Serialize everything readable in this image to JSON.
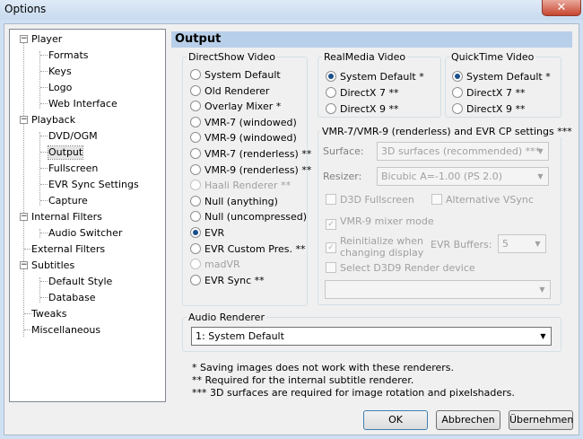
{
  "window": {
    "title": "Options",
    "close_glyph": "✕"
  },
  "tree": {
    "items": [
      {
        "label": "Player",
        "expander": "−"
      },
      {
        "label": "Formats"
      },
      {
        "label": "Keys"
      },
      {
        "label": "Logo"
      },
      {
        "label": "Web Interface"
      },
      {
        "label": "Playback",
        "expander": "−"
      },
      {
        "label": "DVD/OGM"
      },
      {
        "label": "Output",
        "selected": true
      },
      {
        "label": "Fullscreen"
      },
      {
        "label": "EVR Sync Settings"
      },
      {
        "label": "Capture"
      },
      {
        "label": "Internal Filters",
        "expander": "−"
      },
      {
        "label": "Audio Switcher"
      },
      {
        "label": "External Filters"
      },
      {
        "label": "Subtitles",
        "expander": "−"
      },
      {
        "label": "Default Style"
      },
      {
        "label": "Database"
      },
      {
        "label": "Tweaks"
      },
      {
        "label": "Miscellaneous"
      }
    ]
  },
  "page": {
    "header": "Output"
  },
  "directshow": {
    "label": "DirectShow Video",
    "options": [
      {
        "label": "System Default",
        "checked": false,
        "disabled": false
      },
      {
        "label": "Old Renderer",
        "checked": false,
        "disabled": false
      },
      {
        "label": "Overlay Mixer *",
        "checked": false,
        "disabled": false
      },
      {
        "label": "VMR-7 (windowed)",
        "checked": false,
        "disabled": false
      },
      {
        "label": "VMR-9 (windowed)",
        "checked": false,
        "disabled": false
      },
      {
        "label": "VMR-7 (renderless) **",
        "checked": false,
        "disabled": false
      },
      {
        "label": "VMR-9 (renderless) **",
        "checked": false,
        "disabled": false
      },
      {
        "label": "Haali Renderer **",
        "checked": false,
        "disabled": true
      },
      {
        "label": "Null (anything)",
        "checked": false,
        "disabled": false
      },
      {
        "label": "Null (uncompressed)",
        "checked": false,
        "disabled": false
      },
      {
        "label": "EVR",
        "checked": true,
        "disabled": false
      },
      {
        "label": "EVR Custom Pres. **",
        "checked": false,
        "disabled": false
      },
      {
        "label": "madVR",
        "checked": false,
        "disabled": true
      },
      {
        "label": "EVR Sync **",
        "checked": false,
        "disabled": false
      }
    ]
  },
  "realmedia": {
    "label": "RealMedia Video",
    "options": [
      {
        "label": "System Default *",
        "checked": true
      },
      {
        "label": "DirectX 7 **",
        "checked": false
      },
      {
        "label": "DirectX 9 **",
        "checked": false
      }
    ]
  },
  "quicktime": {
    "label": "QuickTime Video",
    "options": [
      {
        "label": "System Default *",
        "checked": true
      },
      {
        "label": "DirectX 7 **",
        "checked": false
      },
      {
        "label": "DirectX 9 **",
        "checked": false
      }
    ]
  },
  "evrcp": {
    "label": "VMR-7/VMR-9 (renderless) and EVR CP settings ***",
    "surface_label": "Surface:",
    "surface_value": "3D surfaces (recommended) ***",
    "resizer_label": "Resizer:",
    "resizer_value": "Bicubic A=-1.00 (PS 2.0)",
    "d3d_fullscreen": {
      "label": "D3D Fullscreen",
      "checked": false
    },
    "alt_vsync": {
      "label": "Alternative VSync",
      "checked": false
    },
    "vmr9_mixer": {
      "label": "VMR-9 mixer mode",
      "checked": true
    },
    "reinit": {
      "label": "Reinitialize when",
      "label2": "changing display",
      "checked": true
    },
    "evr_buffers_label": "EVR Buffers:",
    "evr_buffers_value": "5",
    "select_device": {
      "label": "Select D3D9 Render device",
      "checked": false
    },
    "device_value": ""
  },
  "audio": {
    "label": "Audio Renderer",
    "value": "1: System Default"
  },
  "notes": [
    "* Saving images does not work with these renderers.",
    "** Required for the internal subtitle renderer.",
    "*** 3D surfaces are required for image rotation and pixelshaders."
  ],
  "buttons": {
    "ok": "OK",
    "cancel": "Abbrechen",
    "apply": "Übernehmen"
  },
  "glyphs": {
    "radio_on": "●",
    "check": "✓",
    "dropdown": "▼"
  }
}
